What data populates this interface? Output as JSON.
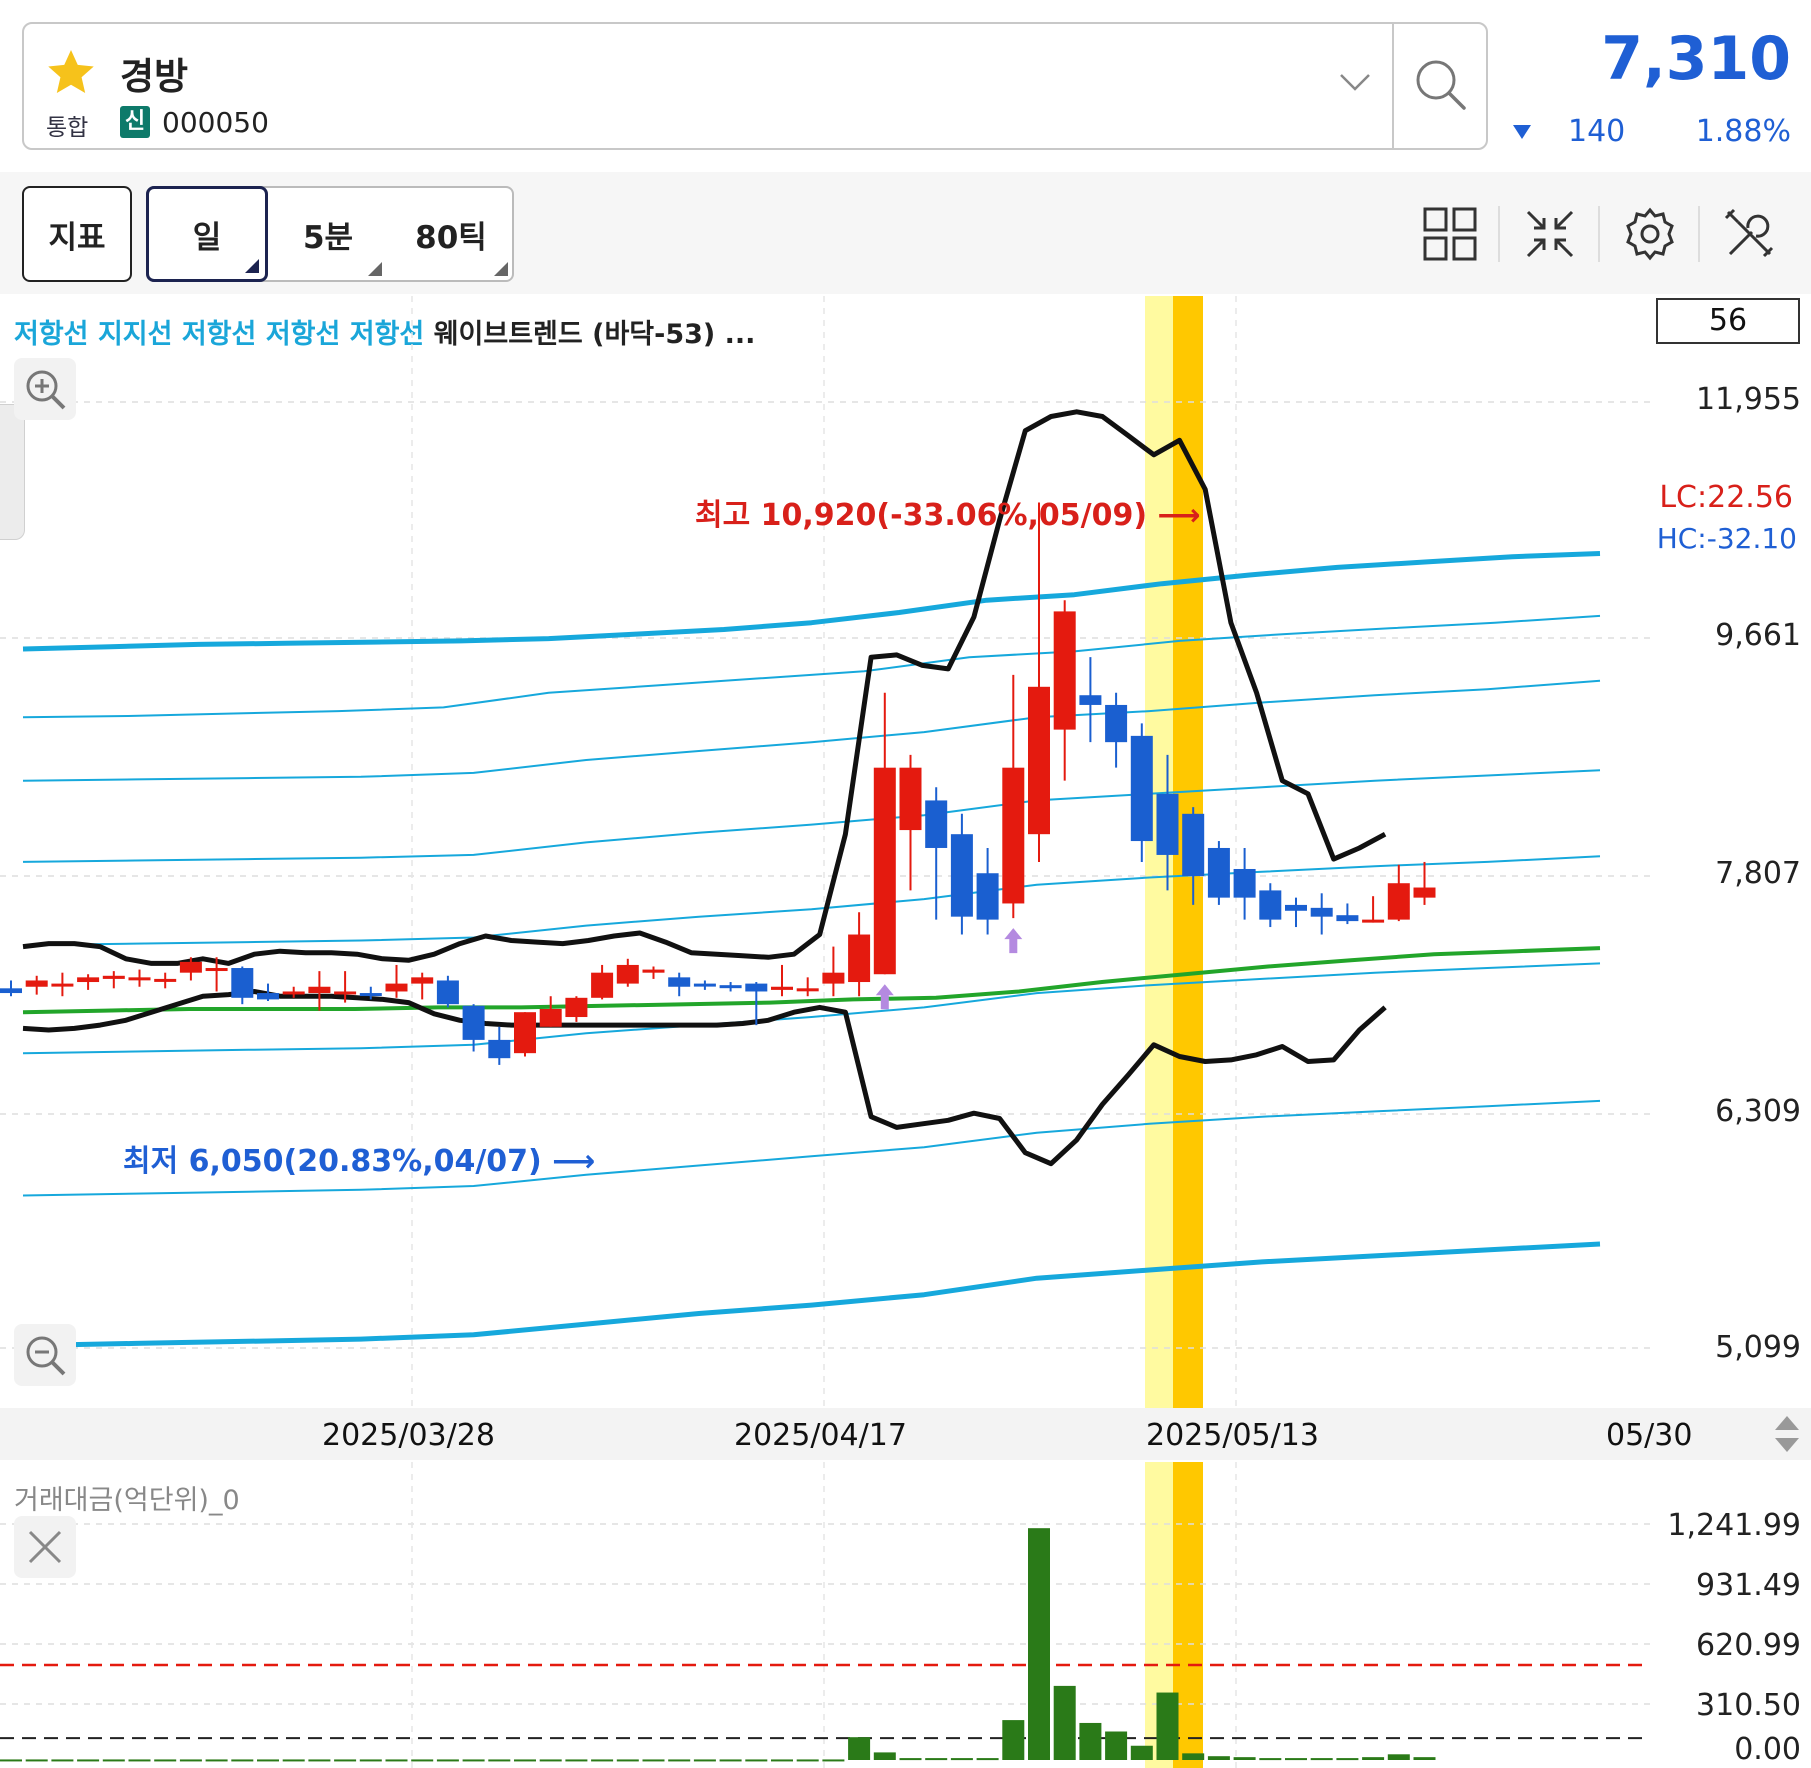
{
  "header": {
    "stock_name": "경방",
    "market_label": "통합",
    "credit_badge": "신",
    "stock_code": "000050",
    "price": "7,310",
    "change": "140",
    "change_pct": "1.88%",
    "change_direction": "down",
    "price_color": "#1f5fd4"
  },
  "toolbar": {
    "indicator_label": "지표",
    "periods": [
      "일",
      "5분",
      "80틱"
    ],
    "selected_period": "일",
    "icons": [
      "layout-grid-icon",
      "collapse-icon",
      "gear-icon",
      "tools-icon"
    ]
  },
  "chart": {
    "legend": {
      "items": [
        "저항선",
        "지지선",
        "저항선",
        "저항선",
        "저항선"
      ],
      "rest": "웨이브트렌드 (바닥-53) ..."
    },
    "count_badge": "56",
    "y_ticks": [
      "11,955",
      "9,661",
      "7,807",
      "6,309",
      "5,099"
    ],
    "lc_label": "LC:22.56",
    "hc_label": "HC:-32.10",
    "high_annotation": "최고 10,920(-33.06%,05/09)",
    "low_annotation": "최저 6,050(20.83%,04/07)",
    "x_ticks": [
      "2025/03/28",
      "2025/04/17",
      "2025/05/13",
      "05/30"
    ],
    "colors": {
      "up": "#e41a0f",
      "down": "#1a5fd0",
      "channel": "#111111",
      "resistance": "#16a8dc",
      "support": "#22a52a"
    }
  },
  "volume": {
    "title": "거래대금(억단위)_0",
    "y_ticks": [
      "1,241.99",
      "931.49",
      "620.99",
      "310.50",
      "0.00"
    ]
  },
  "chart_data": {
    "type": "candlestick",
    "title": "",
    "ylim": [
      5099,
      11955
    ],
    "y_scale": "log",
    "candles": [
      {
        "o": 7050,
        "h": 7100,
        "l": 7000,
        "c": 7020
      },
      {
        "o": 7060,
        "h": 7130,
        "l": 7010,
        "c": 7100
      },
      {
        "o": 7070,
        "h": 7150,
        "l": 7000,
        "c": 7080
      },
      {
        "o": 7090,
        "h": 7140,
        "l": 7040,
        "c": 7120
      },
      {
        "o": 7110,
        "h": 7160,
        "l": 7050,
        "c": 7130
      },
      {
        "o": 7120,
        "h": 7170,
        "l": 7060,
        "c": 7120
      },
      {
        "o": 7110,
        "h": 7150,
        "l": 7050,
        "c": 7110
      },
      {
        "o": 7150,
        "h": 7250,
        "l": 7100,
        "c": 7220
      },
      {
        "o": 7180,
        "h": 7250,
        "l": 7030,
        "c": 7180
      },
      {
        "o": 7180,
        "h": 7190,
        "l": 6950,
        "c": 6990
      },
      {
        "o": 7020,
        "h": 7080,
        "l": 6970,
        "c": 6980
      },
      {
        "o": 7030,
        "h": 7060,
        "l": 6990,
        "c": 7030
      },
      {
        "o": 7020,
        "h": 7160,
        "l": 6910,
        "c": 7060
      },
      {
        "o": 7030,
        "h": 7160,
        "l": 6960,
        "c": 7030
      },
      {
        "o": 7020,
        "h": 7060,
        "l": 6980,
        "c": 7010
      },
      {
        "o": 7030,
        "h": 7200,
        "l": 6990,
        "c": 7080
      },
      {
        "o": 7080,
        "h": 7150,
        "l": 6980,
        "c": 7120
      },
      {
        "o": 7100,
        "h": 7130,
        "l": 6930,
        "c": 6950
      },
      {
        "o": 6940,
        "h": 6950,
        "l": 6660,
        "c": 6730
      },
      {
        "o": 6730,
        "h": 6810,
        "l": 6580,
        "c": 6620
      },
      {
        "o": 6650,
        "h": 6900,
        "l": 6630,
        "c": 6900
      },
      {
        "o": 6810,
        "h": 7000,
        "l": 6810,
        "c": 6920
      },
      {
        "o": 6870,
        "h": 7000,
        "l": 6840,
        "c": 6990
      },
      {
        "o": 6990,
        "h": 7200,
        "l": 6980,
        "c": 7150
      },
      {
        "o": 7080,
        "h": 7240,
        "l": 7060,
        "c": 7200
      },
      {
        "o": 7150,
        "h": 7190,
        "l": 7110,
        "c": 7170
      },
      {
        "o": 7120,
        "h": 7150,
        "l": 7000,
        "c": 7060
      },
      {
        "o": 7080,
        "h": 7100,
        "l": 7040,
        "c": 7070
      },
      {
        "o": 7070,
        "h": 7090,
        "l": 7030,
        "c": 7060
      },
      {
        "o": 7080,
        "h": 7090,
        "l": 6820,
        "c": 7030
      },
      {
        "o": 7040,
        "h": 7200,
        "l": 7000,
        "c": 7060
      },
      {
        "o": 7050,
        "h": 7120,
        "l": 7000,
        "c": 7050
      },
      {
        "o": 7080,
        "h": 7320,
        "l": 7000,
        "c": 7150
      },
      {
        "o": 7090,
        "h": 7550,
        "l": 7000,
        "c": 7400
      },
      {
        "o": 7140,
        "h": 9200,
        "l": 7140,
        "c": 8600
      },
      {
        "o": 8130,
        "h": 8700,
        "l": 7700,
        "c": 8600
      },
      {
        "o": 8350,
        "h": 8450,
        "l": 7500,
        "c": 8000
      },
      {
        "o": 8100,
        "h": 8250,
        "l": 7400,
        "c": 7520
      },
      {
        "o": 7820,
        "h": 8000,
        "l": 7400,
        "c": 7500
      },
      {
        "o": 7610,
        "h": 9350,
        "l": 7510,
        "c": 8600
      },
      {
        "o": 8100,
        "h": 10920,
        "l": 7900,
        "c": 9250
      },
      {
        "o": 8900,
        "h": 10000,
        "l": 8500,
        "c": 9900
      },
      {
        "o": 9180,
        "h": 9500,
        "l": 8800,
        "c": 9100
      },
      {
        "o": 9100,
        "h": 9200,
        "l": 8600,
        "c": 8800
      },
      {
        "o": 8850,
        "h": 8950,
        "l": 7900,
        "c": 8050
      },
      {
        "o": 8400,
        "h": 8700,
        "l": 7700,
        "c": 7950
      },
      {
        "o": 8250,
        "h": 8300,
        "l": 7600,
        "c": 7800
      },
      {
        "o": 8000,
        "h": 8050,
        "l": 7600,
        "c": 7650
      },
      {
        "o": 7850,
        "h": 8000,
        "l": 7500,
        "c": 7650
      },
      {
        "o": 7700,
        "h": 7750,
        "l": 7450,
        "c": 7500
      },
      {
        "o": 7600,
        "h": 7650,
        "l": 7450,
        "c": 7560
      },
      {
        "o": 7580,
        "h": 7680,
        "l": 7400,
        "c": 7520
      },
      {
        "o": 7530,
        "h": 7610,
        "l": 7470,
        "c": 7490
      },
      {
        "o": 7490,
        "h": 7660,
        "l": 7480,
        "c": 7500
      },
      {
        "o": 7500,
        "h": 7880,
        "l": 7490,
        "c": 7750
      },
      {
        "o": 7650,
        "h": 7900,
        "l": 7600,
        "c": 7720
      }
    ],
    "upper_channel": [
      7320,
      7340,
      7340,
      7320,
      7240,
      7210,
      7210,
      7240,
      7210,
      7270,
      7290,
      7280,
      7280,
      7270,
      7240,
      7230,
      7270,
      7340,
      7390,
      7360,
      7350,
      7340,
      7360,
      7390,
      7410,
      7350,
      7280,
      7270,
      7260,
      7250,
      7270,
      7400,
      8100,
      9500,
      9520,
      9430,
      9400,
      9850,
      10750,
      11650,
      11800,
      11850,
      11800,
      11600,
      11400,
      11550,
      11050,
      9800,
      9200,
      8500,
      8400,
      7920,
      8000,
      8100
    ],
    "lower_channel": [
      6800,
      6790,
      6800,
      6820,
      6850,
      6900,
      6950,
      7000,
      7010,
      7030,
      7000,
      7000,
      7000,
      6990,
      6980,
      6960,
      6890,
      6850,
      6830,
      6820,
      6820,
      6820,
      6820,
      6820,
      6820,
      6820,
      6820,
      6820,
      6830,
      6850,
      6900,
      6930,
      6900,
      6280,
      6220,
      6240,
      6260,
      6300,
      6270,
      6080,
      6020,
      6150,
      6350,
      6520,
      6700,
      6630,
      6600,
      6610,
      6640,
      6690,
      6600,
      6610,
      6790,
      6930
    ],
    "resistance_lines": [
      {
        "values": [
          9570,
          9590,
          9610,
          9620,
          9630,
          9640,
          9660,
          9700,
          9740,
          9800,
          9890,
          10000,
          10050,
          10150,
          10230,
          10300,
          10350,
          10400,
          10430
        ]
      },
      {
        "values": [
          9000,
          9010,
          9030,
          9050,
          9080,
          9200,
          9260,
          9320,
          9380,
          9500,
          9550,
          9640,
          9700,
          9750,
          9800,
          9860
        ]
      },
      {
        "values": [
          8500,
          8510,
          8520,
          8530,
          8560,
          8660,
          8730,
          8800,
          8880,
          9000,
          9050,
          9120,
          9180,
          9230,
          9300
        ]
      },
      {
        "values": [
          7900,
          7910,
          7920,
          7930,
          7950,
          8040,
          8110,
          8170,
          8240,
          8350,
          8400,
          8450,
          8500,
          8540,
          8580
        ]
      },
      {
        "values": [
          7330,
          7340,
          7350,
          7360,
          7380,
          7460,
          7520,
          7570,
          7640,
          7740,
          7790,
          7830,
          7870,
          7900,
          7940
        ]
      },
      {
        "values": [
          6650,
          6660,
          6670,
          6680,
          6700,
          6770,
          6820,
          6870,
          6930,
          7020,
          7070,
          7110,
          7150,
          7180,
          7210
        ]
      }
    ],
    "support_line": [
      6900,
      6910,
      6920,
      6920,
      6920,
      6930,
      6930,
      6940,
      6950,
      6960,
      6980,
      6990,
      7030,
      7090,
      7140,
      7190,
      7230,
      7270,
      7290,
      7310
    ],
    "lower_support_lines": [
      {
        "values": [
          5850,
          5860,
          5870,
          5880,
          5900,
          5960,
          6010,
          6060,
          6110,
          6190,
          6240,
          6280,
          6310,
          6340,
          6370
        ]
      },
      {
        "values": [
          5110,
          5120,
          5130,
          5140,
          5160,
          5210,
          5260,
          5300,
          5350,
          5430,
          5470,
          5510,
          5540,
          5570,
          5600
        ]
      }
    ],
    "volume_values": [
      3,
      3,
      3,
      3,
      3,
      3,
      3,
      3,
      3,
      3,
      3,
      3,
      3,
      3,
      3,
      3,
      3,
      3,
      3,
      3,
      3,
      3,
      3,
      3,
      3,
      3,
      3,
      3,
      3,
      3,
      3,
      3,
      3,
      120,
      40,
      10,
      10,
      10,
      10,
      210,
      1220,
      390,
      195,
      150,
      75,
      355,
      35,
      20,
      15,
      10,
      10,
      10,
      10,
      15,
      30,
      15
    ],
    "volume_ylim": [
      0,
      1241.99
    ],
    "volume_threshold": 500,
    "highlight_days": [
      39,
      40
    ]
  }
}
